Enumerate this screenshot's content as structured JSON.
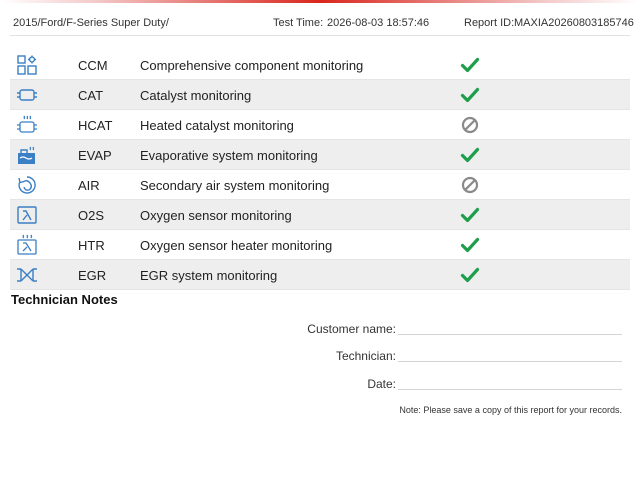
{
  "header": {
    "vehicle": "2015/Ford/F-Series Super Duty/",
    "test_time_label": "Test Time:",
    "test_time_value": "2026-08-03 18:57:46",
    "report_id_label": "Report ID:",
    "report_id_value": "MAXIA20260803185746"
  },
  "monitors": [
    {
      "code": "CCM",
      "description": "Comprehensive component monitoring",
      "status": "complete",
      "icon": "ccm-icon"
    },
    {
      "code": "CAT",
      "description": "Catalyst monitoring",
      "status": "complete",
      "icon": "catalyst-icon"
    },
    {
      "code": "HCAT",
      "description": "Heated catalyst monitoring",
      "status": "not-supported",
      "icon": "heated-catalyst-icon"
    },
    {
      "code": "EVAP",
      "description": "Evaporative system monitoring",
      "status": "complete",
      "icon": "evap-icon"
    },
    {
      "code": "AIR",
      "description": "Secondary air system monitoring",
      "status": "not-supported",
      "icon": "secondary-air-icon"
    },
    {
      "code": "O2S",
      "description": "Oxygen sensor monitoring",
      "status": "complete",
      "icon": "oxygen-sensor-icon"
    },
    {
      "code": "HTR",
      "description": "Oxygen sensor heater monitoring",
      "status": "complete",
      "icon": "oxygen-sensor-heater-icon"
    },
    {
      "code": "EGR",
      "description": "EGR system monitoring",
      "status": "complete",
      "icon": "egr-icon"
    }
  ],
  "notes": {
    "title": "Technician Notes",
    "customer_name_label": "Customer name:",
    "technician_label": "Technician:",
    "date_label": "Date:",
    "footer_note": "Note: Please save a copy of this report for your records."
  },
  "colors": {
    "accent": "#d9261c",
    "check": "#1e9e4a",
    "not_supported": "#8a8a8a",
    "icon_blue": "#3b7fc4"
  }
}
